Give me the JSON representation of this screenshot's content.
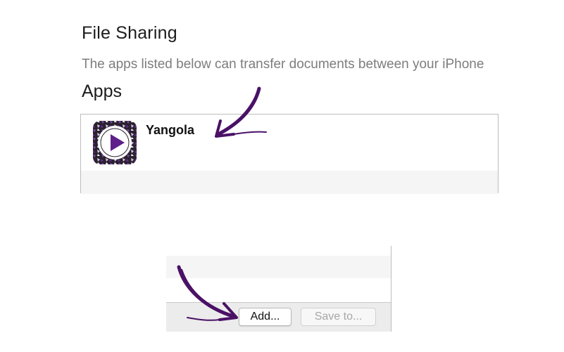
{
  "file_sharing": {
    "title": "File Sharing",
    "description": "The apps listed below can transfer documents between your iPhone"
  },
  "apps": {
    "title": "Apps",
    "items": [
      {
        "name": "Yangola",
        "icon": "play-icon"
      }
    ]
  },
  "footer": {
    "add_label": "Add...",
    "save_label": "Save to..."
  },
  "annotations": {
    "arrow_color": "#4a1166"
  },
  "colors": {
    "icon_purple": "#6a2b8f",
    "icon_dark": "#2a2230"
  }
}
